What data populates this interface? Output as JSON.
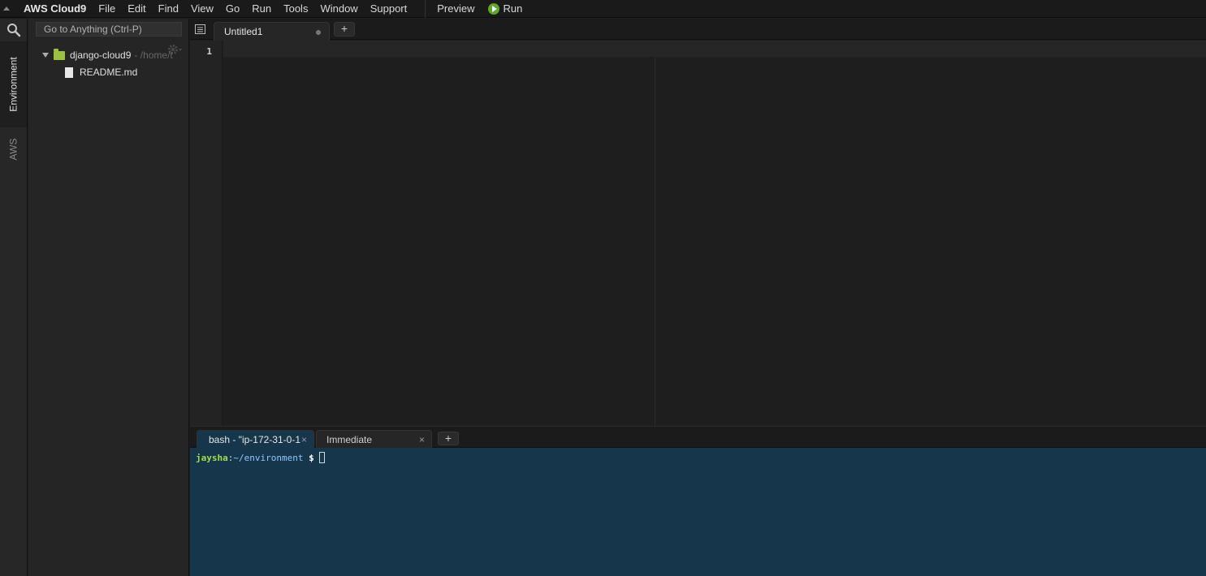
{
  "menubar": {
    "brand": "AWS Cloud9",
    "items": [
      "File",
      "Edit",
      "Find",
      "View",
      "Go",
      "Run",
      "Tools",
      "Window",
      "Support"
    ],
    "preview": "Preview",
    "run": "Run"
  },
  "sidebar": {
    "tabs": [
      "Environment",
      "AWS"
    ],
    "goto_placeholder": "Go to Anything (Ctrl-P)"
  },
  "tree": {
    "root_name": "django-cloud9",
    "root_path": "- /home/t",
    "files": [
      "README.md"
    ]
  },
  "editor": {
    "tabs": [
      {
        "label": "Untitled1"
      }
    ],
    "add_tab": "+",
    "line_numbers": [
      "1"
    ]
  },
  "terminal": {
    "tabs": [
      {
        "label": "bash - \"ip-172-31-0-1",
        "close": "×"
      },
      {
        "label": "Immediate",
        "close": "×"
      }
    ],
    "add_tab": "+",
    "prompt": {
      "user": "jaysha",
      "colon": ":",
      "path": "~/environment",
      "dollar": " $"
    }
  },
  "colors": {
    "terminal_bg": "#16364b",
    "folder": "#9bc13f",
    "run_green": "#5da82b",
    "prompt_user": "#9fe04a",
    "prompt_path": "#8fc6ff"
  }
}
